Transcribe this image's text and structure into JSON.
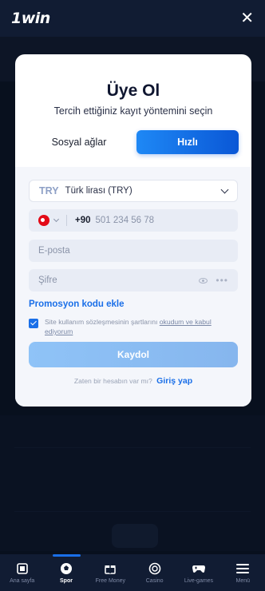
{
  "header": {
    "logo": "1win",
    "close_glyph": "✕"
  },
  "modal": {
    "title": "Üye Ol",
    "subtitle": "Tercih ettiğiniz kayıt yöntemini seçin",
    "tabs": [
      {
        "label": "Sosyal ağlar",
        "active": false
      },
      {
        "label": "Hızlı",
        "active": true
      }
    ],
    "currency": {
      "code": "TRY",
      "name": "Türk lirası (TRY)"
    },
    "phone": {
      "dial_code": "+90",
      "placeholder": "501 234 56 78",
      "flag": "turkey-flag-icon"
    },
    "email": {
      "placeholder": "E-posta"
    },
    "password": {
      "placeholder": "Şifre"
    },
    "promo_link": "Promosyon kodu ekle",
    "terms": {
      "checked": true,
      "text": "Site kullanım sözleşmesinin şartlarını",
      "link": "okudum ve kabul ediyorum"
    },
    "submit_label": "Kaydol",
    "login_prompt": "Zaten bir hesabın var mı?",
    "login_link": "Giriş yap"
  },
  "bottom_nav": [
    {
      "label": "Ana sayfa",
      "icon": "home-icon",
      "active": false
    },
    {
      "label": "Spor",
      "icon": "football-icon",
      "active": true
    },
    {
      "label": "Free Money",
      "icon": "gift-icon",
      "active": false
    },
    {
      "label": "Casino",
      "icon": "chip-icon",
      "active": false
    },
    {
      "label": "Live-games",
      "icon": "gamepad-icon",
      "active": false
    },
    {
      "label": "Menü",
      "icon": "menu-icon",
      "active": false
    }
  ],
  "colors": {
    "accent": "#1a6fe8",
    "bg": "#0b1426",
    "modal": "#ffffff"
  }
}
